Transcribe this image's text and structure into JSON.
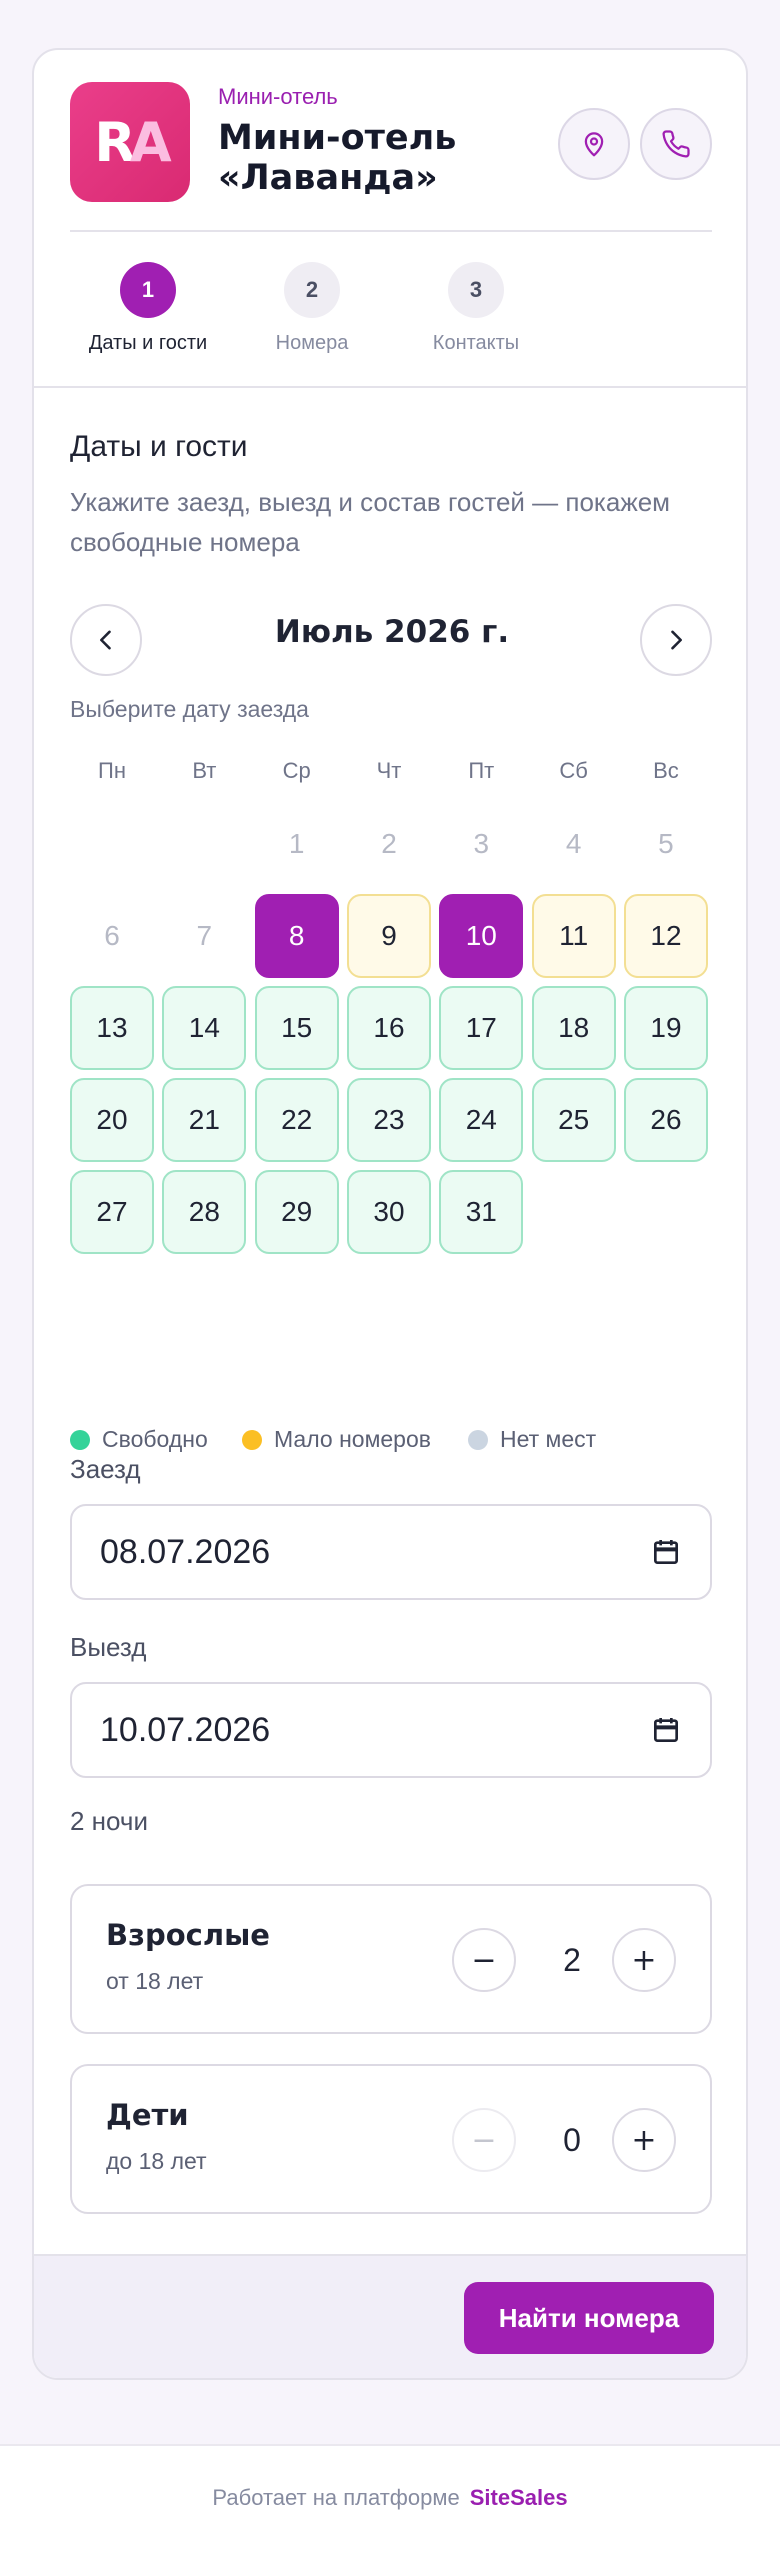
{
  "header": {
    "subtitle": "Мини-отель",
    "hotel_name": "Мини-отель «Лаванда»",
    "logo_text_1": "R",
    "logo_text_2": "A"
  },
  "steps": [
    {
      "num": "1",
      "label": "Даты и гости",
      "active": true
    },
    {
      "num": "2",
      "label": "Номера",
      "active": false
    },
    {
      "num": "3",
      "label": "Контакты",
      "active": false
    }
  ],
  "section": {
    "title": "Даты и гости",
    "description": "Укажите заезд, выезд и состав гостей — покажем свободные номера"
  },
  "calendar": {
    "month_title": "Июль 2026 г.",
    "hint": "Выберите дату заезда",
    "weekdays": [
      "Пн",
      "Вт",
      "Ср",
      "Чт",
      "Пт",
      "Сб",
      "Вс"
    ],
    "days": [
      {
        "d": "",
        "s": "none"
      },
      {
        "d": "",
        "s": "none"
      },
      {
        "d": "1",
        "s": "empty"
      },
      {
        "d": "2",
        "s": "empty"
      },
      {
        "d": "3",
        "s": "empty"
      },
      {
        "d": "4",
        "s": "empty"
      },
      {
        "d": "5",
        "s": "empty"
      },
      {
        "d": "6",
        "s": "empty"
      },
      {
        "d": "7",
        "s": "empty"
      },
      {
        "d": "8",
        "s": "selected"
      },
      {
        "d": "9",
        "s": "few"
      },
      {
        "d": "10",
        "s": "selected"
      },
      {
        "d": "11",
        "s": "few"
      },
      {
        "d": "12",
        "s": "few"
      },
      {
        "d": "13",
        "s": "free"
      },
      {
        "d": "14",
        "s": "free"
      },
      {
        "d": "15",
        "s": "free"
      },
      {
        "d": "16",
        "s": "free"
      },
      {
        "d": "17",
        "s": "free"
      },
      {
        "d": "18",
        "s": "free"
      },
      {
        "d": "19",
        "s": "free"
      },
      {
        "d": "20",
        "s": "free"
      },
      {
        "d": "21",
        "s": "free"
      },
      {
        "d": "22",
        "s": "free"
      },
      {
        "d": "23",
        "s": "free"
      },
      {
        "d": "24",
        "s": "free"
      },
      {
        "d": "25",
        "s": "free"
      },
      {
        "d": "26",
        "s": "free"
      },
      {
        "d": "27",
        "s": "free"
      },
      {
        "d": "28",
        "s": "free"
      },
      {
        "d": "29",
        "s": "free"
      },
      {
        "d": "30",
        "s": "free"
      },
      {
        "d": "31",
        "s": "free"
      }
    ]
  },
  "legend": [
    {
      "label": "Свободно",
      "color": "#34d399"
    },
    {
      "label": "Мало номеров",
      "color": "#fbbf24"
    },
    {
      "label": "Нет мест",
      "color": "#cbd5e1"
    }
  ],
  "form": {
    "checkin_label": "Заезд",
    "checkin_value": "08.07.2026",
    "checkout_label": "Выезд",
    "checkout_value": "10.07.2026",
    "nights": "2 ночи"
  },
  "guests": {
    "adults": {
      "title": "Взрослые",
      "subtitle": "от 18 лет",
      "count": "2",
      "minus": "−",
      "plus": "+"
    },
    "children": {
      "title": "Дети",
      "subtitle": "до 18 лет",
      "count": "0",
      "minus": "−",
      "plus": "+"
    }
  },
  "actions": {
    "find_label": "Найти номера"
  },
  "footer": {
    "text": "Работает на платформе",
    "brand": "SiteSales"
  },
  "colors": {
    "accent": "#a01fb2",
    "logo": "#e0337e"
  },
  "icons": [
    "location-pin-icon",
    "phone-icon",
    "chevron-left-icon",
    "chevron-right-icon",
    "calendar-icon"
  ]
}
